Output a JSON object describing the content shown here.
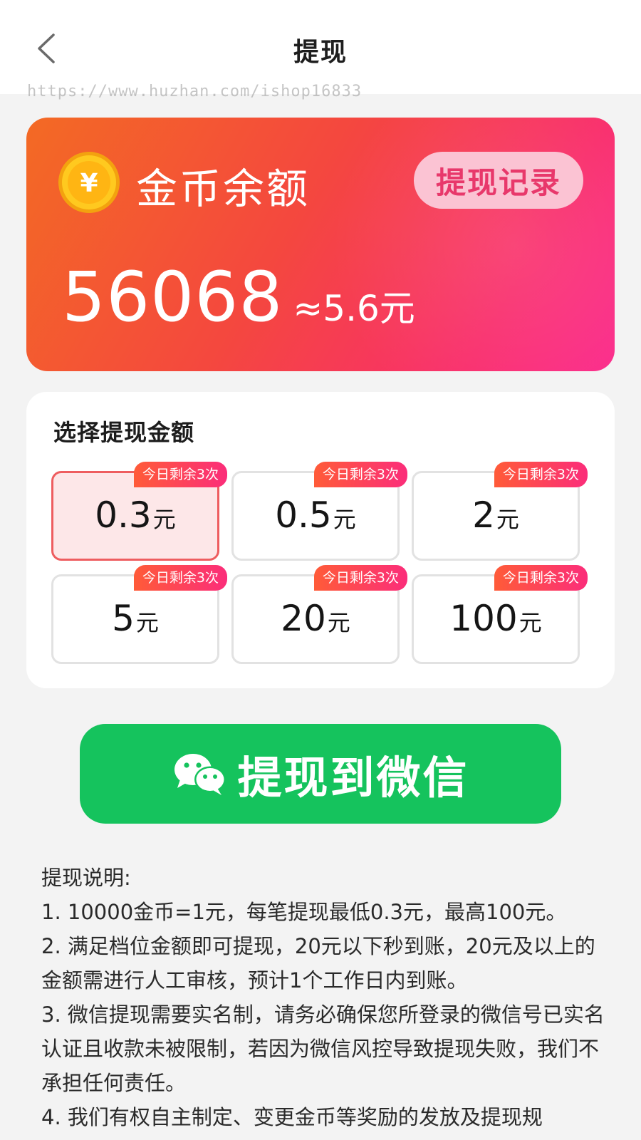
{
  "header": {
    "title": "提现",
    "watermark": "https://www.huzhan.com/ishop16833"
  },
  "balance": {
    "label": "金币余额",
    "records_button": "提现记录",
    "amount": "56068",
    "approx": "≈5.6元",
    "coin_symbol": "¥",
    "colors": {
      "gradient_start": "#f36a24",
      "gradient_end": "#fb2c8c"
    }
  },
  "amounts": {
    "title": "选择提现金额",
    "unit": "元",
    "options": [
      {
        "value": "0.3",
        "badge": "今日剩余3次",
        "selected": true
      },
      {
        "value": "0.5",
        "badge": "今日剩余3次",
        "selected": false
      },
      {
        "value": "2",
        "badge": "今日剩余3次",
        "selected": false
      },
      {
        "value": "5",
        "badge": "今日剩余3次",
        "selected": false
      },
      {
        "value": "20",
        "badge": "今日剩余3次",
        "selected": false
      },
      {
        "value": "100",
        "badge": "今日剩余3次",
        "selected": false
      }
    ]
  },
  "withdraw_button": {
    "label": "提现到微信",
    "icon": "wechat-icon",
    "color": "#15c35d"
  },
  "notes": {
    "title": "提现说明:",
    "items": [
      "1. 10000金币=1元，每笔提现最低0.3元，最高100元。",
      "2. 满足档位金额即可提现，20元以下秒到账，20元及以上的金额需进行人工审核，预计1个工作日内到账。",
      "3. 微信提现需要实名制，请务必确保您所登录的微信号已实名认证且收款未被限制，若因为微信风控导致提现失败，我们不承担任何责任。",
      "4. 我们有权自主制定、变更金币等奖励的发放及提现规"
    ]
  }
}
